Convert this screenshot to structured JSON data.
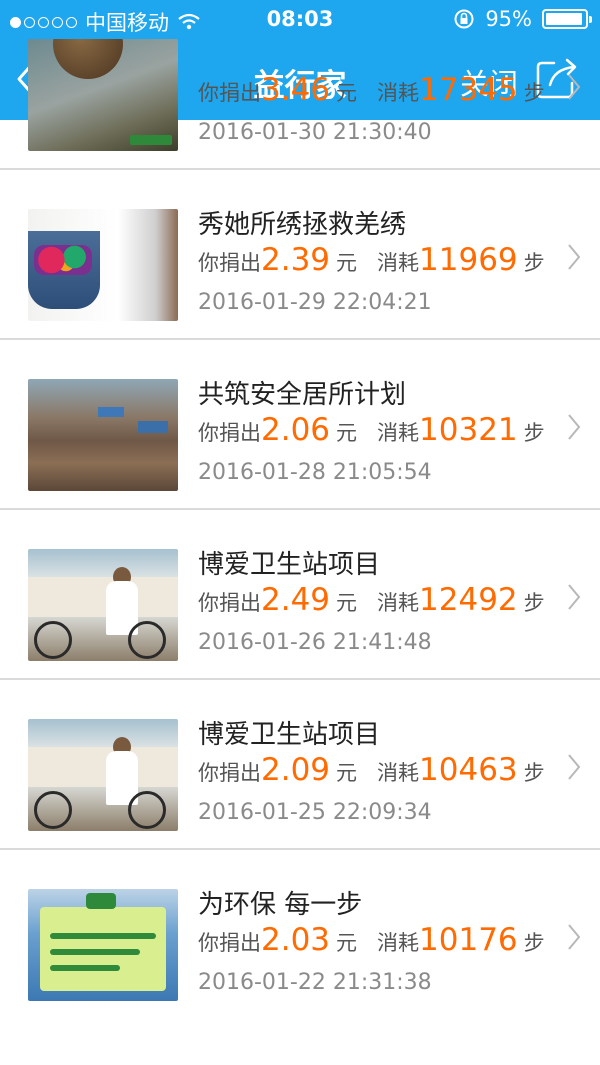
{
  "status_bar": {
    "carrier": "中国移动",
    "time": "08:03",
    "battery": "95%",
    "battery_level": 0.95
  },
  "nav": {
    "back_label": "返回",
    "title": "益行家",
    "close_label": "关闭"
  },
  "labels": {
    "donated": "你捐出",
    "yuan": "元",
    "consumed": "消耗",
    "steps": "步"
  },
  "items": [
    {
      "name": "",
      "amount": "3.46",
      "steps": "17345",
      "date": "2016-01-30 21:30:40"
    },
    {
      "name": "秀她所绣拯救羌绣",
      "amount": "2.39",
      "steps": "11969",
      "date": "2016-01-29 22:04:21"
    },
    {
      "name": "共筑安全居所计划",
      "amount": "2.06",
      "steps": "10321",
      "date": "2016-01-28 21:05:54"
    },
    {
      "name": "博爱卫生站项目",
      "amount": "2.49",
      "steps": "12492",
      "date": "2016-01-26 21:41:48"
    },
    {
      "name": "博爱卫生站项目",
      "amount": "2.09",
      "steps": "10463",
      "date": "2016-01-25 22:09:34"
    },
    {
      "name": "为环保 每一步",
      "amount": "2.03",
      "steps": "10176",
      "date": "2016-01-22 21:31:38"
    }
  ],
  "colors": {
    "nav_bg": "#1ea6ee",
    "amount": "#ff6b00"
  }
}
